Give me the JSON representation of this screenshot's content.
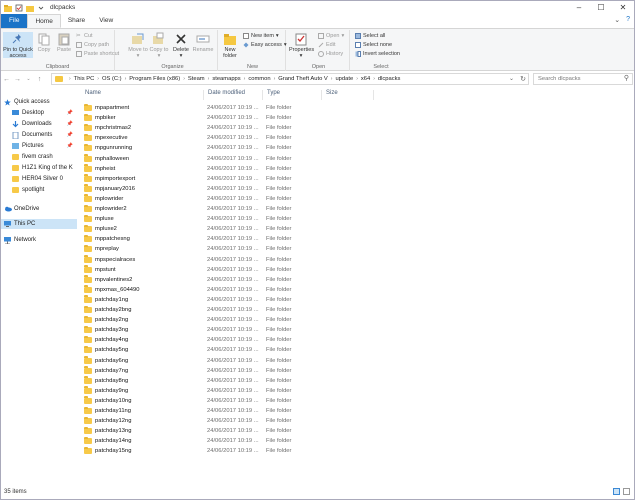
{
  "window": {
    "title": "dlcpacks"
  },
  "tabs": [
    "File",
    "Home",
    "Share",
    "View"
  ],
  "ribbon": {
    "clipboard": {
      "label": "Clipboard",
      "pin": "Pin to Quick access",
      "copy": "Copy",
      "paste": "Paste",
      "cut": "Cut",
      "copy_path": "Copy path",
      "paste_shortcut": "Paste shortcut"
    },
    "organize": {
      "label": "Organize",
      "move_to": "Move to",
      "copy_to": "Copy to",
      "delete": "Delete",
      "rename": "Rename"
    },
    "new": {
      "label": "New",
      "new_folder": "New folder",
      "new_item": "New item",
      "easy_access": "Easy access"
    },
    "open": {
      "label": "Open",
      "properties": "Properties",
      "open": "Open",
      "edit": "Edit",
      "history": "History"
    },
    "select": {
      "label": "Select",
      "select_all": "Select all",
      "select_none": "Select none",
      "invert": "Invert selection"
    }
  },
  "address": {
    "crumbs": [
      "This PC",
      "OS (C:)",
      "Program Files (x86)",
      "Steam",
      "steamapps",
      "common",
      "Grand Theft Auto V",
      "update",
      "x64",
      "dlcpacks"
    ],
    "search_placeholder": "Search dlcpacks"
  },
  "nav": {
    "items": [
      {
        "label": "Quick access",
        "icon": "star-icon",
        "pinned": false
      },
      {
        "label": "Desktop",
        "icon": "desktop-icon",
        "pinned": true
      },
      {
        "label": "Downloads",
        "icon": "download-icon",
        "pinned": true
      },
      {
        "label": "Documents",
        "icon": "documents-icon",
        "pinned": true
      },
      {
        "label": "Pictures",
        "icon": "pictures-icon",
        "pinned": true
      },
      {
        "label": "fivem crash",
        "icon": "folder-icon",
        "pinned": false
      },
      {
        "label": "H1Z1  King of the K",
        "icon": "folder-icon",
        "pinned": false
      },
      {
        "label": "HER04 Silver 0",
        "icon": "folder-icon",
        "pinned": false
      },
      {
        "label": "spotlight",
        "icon": "folder-icon",
        "pinned": false
      },
      {
        "label": "OneDrive",
        "icon": "cloud-icon",
        "pinned": false
      },
      {
        "label": "This PC",
        "icon": "computer-icon",
        "pinned": false
      },
      {
        "label": "Network",
        "icon": "network-icon",
        "pinned": false
      }
    ]
  },
  "columns": {
    "name": "Name",
    "date": "Date modified",
    "type": "Type",
    "size": "Size"
  },
  "files": [
    {
      "name": "mpapartment",
      "date": "24/06/2017 10:19 ...",
      "type": "File folder"
    },
    {
      "name": "mpbiker",
      "date": "24/06/2017 10:19 ...",
      "type": "File folder"
    },
    {
      "name": "mpchristmas2",
      "date": "24/06/2017 10:19 ...",
      "type": "File folder"
    },
    {
      "name": "mpexecutive",
      "date": "24/06/2017 10:19 ...",
      "type": "File folder"
    },
    {
      "name": "mpgunrunning",
      "date": "24/06/2017 10:19 ...",
      "type": "File folder"
    },
    {
      "name": "mphalloween",
      "date": "24/06/2017 10:19 ...",
      "type": "File folder"
    },
    {
      "name": "mpheist",
      "date": "24/06/2017 10:19 ...",
      "type": "File folder"
    },
    {
      "name": "mpimportexport",
      "date": "24/06/2017 10:19 ...",
      "type": "File folder"
    },
    {
      "name": "mpjanuary2016",
      "date": "24/06/2017 10:19 ...",
      "type": "File folder"
    },
    {
      "name": "mplowrider",
      "date": "24/06/2017 10:19 ...",
      "type": "File folder"
    },
    {
      "name": "mplowrider2",
      "date": "24/06/2017 10:19 ...",
      "type": "File folder"
    },
    {
      "name": "mpluxe",
      "date": "24/06/2017 10:19 ...",
      "type": "File folder"
    },
    {
      "name": "mpluxe2",
      "date": "24/06/2017 10:19 ...",
      "type": "File folder"
    },
    {
      "name": "mppatchesng",
      "date": "24/06/2017 10:19 ...",
      "type": "File folder"
    },
    {
      "name": "mpreplay",
      "date": "24/06/2017 10:19 ...",
      "type": "File folder"
    },
    {
      "name": "mpspecialraces",
      "date": "24/06/2017 10:19 ...",
      "type": "File folder"
    },
    {
      "name": "mpstunt",
      "date": "24/06/2017 10:19 ...",
      "type": "File folder"
    },
    {
      "name": "mpvalentines2",
      "date": "24/06/2017 10:19 ...",
      "type": "File folder"
    },
    {
      "name": "mpxmas_604490",
      "date": "24/06/2017 10:19 ...",
      "type": "File folder"
    },
    {
      "name": "patchday1ng",
      "date": "24/06/2017 10:19 ...",
      "type": "File folder"
    },
    {
      "name": "patchday2bng",
      "date": "24/06/2017 10:19 ...",
      "type": "File folder"
    },
    {
      "name": "patchday2ng",
      "date": "24/06/2017 10:19 ...",
      "type": "File folder"
    },
    {
      "name": "patchday3ng",
      "date": "24/06/2017 10:19 ...",
      "type": "File folder"
    },
    {
      "name": "patchday4ng",
      "date": "24/06/2017 10:19 ...",
      "type": "File folder"
    },
    {
      "name": "patchday5ng",
      "date": "24/06/2017 10:19 ...",
      "type": "File folder"
    },
    {
      "name": "patchday6ng",
      "date": "24/06/2017 10:19 ...",
      "type": "File folder"
    },
    {
      "name": "patchday7ng",
      "date": "24/06/2017 10:19 ...",
      "type": "File folder"
    },
    {
      "name": "patchday8ng",
      "date": "24/06/2017 10:19 ...",
      "type": "File folder"
    },
    {
      "name": "patchday9ng",
      "date": "24/06/2017 10:19 ...",
      "type": "File folder"
    },
    {
      "name": "patchday10ng",
      "date": "24/06/2017 10:19 ...",
      "type": "File folder"
    },
    {
      "name": "patchday11ng",
      "date": "24/06/2017 10:19 ...",
      "type": "File folder"
    },
    {
      "name": "patchday12ng",
      "date": "24/06/2017 10:19 ...",
      "type": "File folder"
    },
    {
      "name": "patchday13ng",
      "date": "24/06/2017 10:19 ...",
      "type": "File folder"
    },
    {
      "name": "patchday14ng",
      "date": "24/06/2017 10:19 ...",
      "type": "File folder"
    },
    {
      "name": "patchday15ng",
      "date": "24/06/2017 10:19 ...",
      "type": "File folder"
    }
  ],
  "status": {
    "count": "35 items"
  },
  "colors": {
    "accent": "#1a73c7",
    "folder": "#f7c948",
    "selection": "#cce4f7"
  }
}
